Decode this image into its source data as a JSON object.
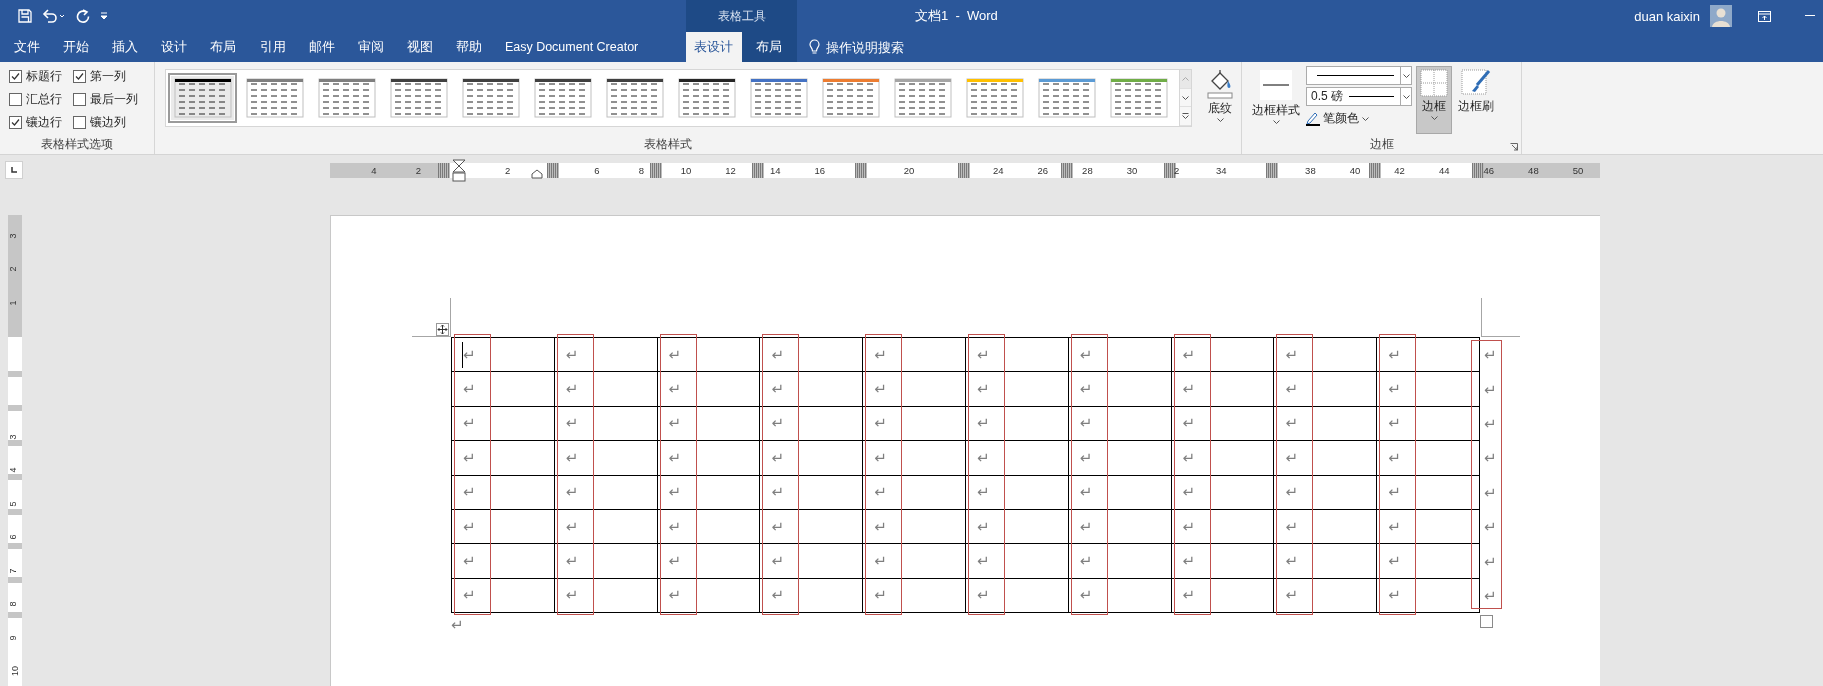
{
  "title_bar": {
    "context_header": "表格工具",
    "title": "文档1  -  Word",
    "user": "duan kaixin"
  },
  "tabs": [
    {
      "label": "文件",
      "selected": false,
      "contextual": false
    },
    {
      "label": "开始",
      "selected": false,
      "contextual": false
    },
    {
      "label": "插入",
      "selected": false,
      "contextual": false
    },
    {
      "label": "设计",
      "selected": false,
      "contextual": false
    },
    {
      "label": "布局",
      "selected": false,
      "contextual": false
    },
    {
      "label": "引用",
      "selected": false,
      "contextual": false
    },
    {
      "label": "邮件",
      "selected": false,
      "contextual": false
    },
    {
      "label": "审阅",
      "selected": false,
      "contextual": false
    },
    {
      "label": "视图",
      "selected": false,
      "contextual": false
    },
    {
      "label": "帮助",
      "selected": false,
      "contextual": false
    },
    {
      "label": "Easy Document Creator",
      "selected": false,
      "contextual": false
    },
    {
      "label": "表设计",
      "selected": true,
      "contextual": true
    },
    {
      "label": "布局",
      "selected": false,
      "contextual": true
    }
  ],
  "tell_me": {
    "placeholder": "操作说明搜索"
  },
  "ribbon": {
    "style_options": {
      "label": "表格样式选项",
      "options": [
        {
          "label": "标题行",
          "checked": true
        },
        {
          "label": "第一列",
          "checked": true
        },
        {
          "label": "汇总行",
          "checked": false
        },
        {
          "label": "最后一列",
          "checked": false
        },
        {
          "label": "镶边行",
          "checked": true
        },
        {
          "label": "镶边列",
          "checked": false
        }
      ]
    },
    "table_styles": {
      "label": "表格样式",
      "styles": [
        {
          "selected": true,
          "color": "#000000"
        },
        {
          "selected": false,
          "color": "#7f7f7f"
        },
        {
          "selected": false,
          "color": "#7f7f7f"
        },
        {
          "selected": false,
          "color": "#404040"
        },
        {
          "selected": false,
          "color": "#404040"
        },
        {
          "selected": false,
          "color": "#404040"
        },
        {
          "selected": false,
          "color": "#404040"
        },
        {
          "selected": false,
          "color": "#262626"
        },
        {
          "selected": false,
          "color": "#4472c4"
        },
        {
          "selected": false,
          "color": "#ed7d31"
        },
        {
          "selected": false,
          "color": "#a5a5a5"
        },
        {
          "selected": false,
          "color": "#ffc000"
        },
        {
          "selected": false,
          "color": "#5b9bd5"
        },
        {
          "selected": false,
          "color": "#70ad47"
        }
      ]
    },
    "shading": {
      "label": "底纹"
    },
    "borders": {
      "label": "边框",
      "border_styles": "边框样式",
      "pen_weight": "0.5 磅",
      "pen_color": "笔颜色",
      "borders_button": {
        "label": "边框",
        "selected": true
      },
      "border_painter": "边框刷"
    }
  },
  "ruler": {
    "horizontal": [
      "4",
      "2",
      "2",
      "6",
      "8",
      "10",
      "12",
      "14",
      "16",
      "20",
      "24",
      "26",
      "28",
      "30",
      "2",
      "34",
      "38",
      "40",
      "42",
      "44",
      "46",
      "48",
      "50"
    ],
    "vertical": [
      "3",
      "2",
      "1",
      "3",
      "4",
      "5",
      "6",
      "7",
      "8",
      "9",
      "10"
    ]
  },
  "document": {
    "table": {
      "rows": [
        {
          "cells": [
            "↵",
            "↵",
            "↵",
            "↵",
            "↵",
            "↵",
            "↵",
            "↵",
            "↵",
            "↵"
          ],
          "end_mark": "↵"
        },
        {
          "cells": [
            "↵",
            "↵",
            "↵",
            "↵",
            "↵",
            "↵",
            "↵",
            "↵",
            "↵",
            "↵"
          ],
          "end_mark": "↵"
        },
        {
          "cells": [
            "↵",
            "↵",
            "↵",
            "↵",
            "↵",
            "↵",
            "↵",
            "↵",
            "↵",
            "↵"
          ],
          "end_mark": "↵"
        },
        {
          "cells": [
            "↵",
            "↵",
            "↵",
            "↵",
            "↵",
            "↵",
            "↵",
            "↵",
            "↵",
            "↵"
          ],
          "end_mark": "↵"
        },
        {
          "cells": [
            "↵",
            "↵",
            "↵",
            "↵",
            "↵",
            "↵",
            "↵",
            "↵",
            "↵",
            "↵"
          ],
          "end_mark": "↵"
        },
        {
          "cells": [
            "↵",
            "↵",
            "↵",
            "↵",
            "↵",
            "↵",
            "↵",
            "↵",
            "↵",
            "↵"
          ],
          "end_mark": "↵"
        },
        {
          "cells": [
            "↵",
            "↵",
            "↵",
            "↵",
            "↵",
            "↵",
            "↵",
            "↵",
            "↵",
            "↵"
          ],
          "end_mark": "↵"
        },
        {
          "cells": [
            "↵",
            "↵",
            "↵",
            "↵",
            "↵",
            "↵",
            "↵",
            "↵",
            "↵",
            "↵"
          ],
          "end_mark": "↵"
        }
      ]
    },
    "paragraph_mark": "↵"
  }
}
